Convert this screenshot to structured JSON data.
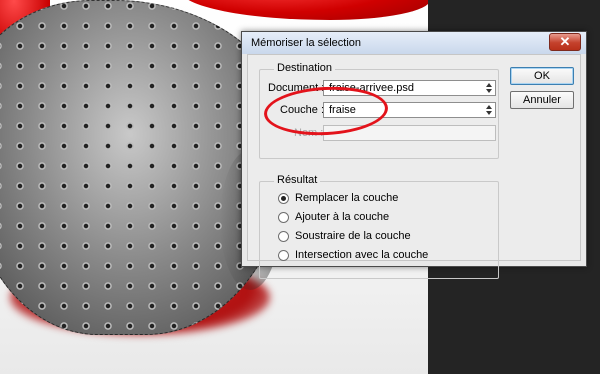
{
  "dialog": {
    "title": "Mémoriser la sélection",
    "close_glyph": "✕"
  },
  "destination": {
    "legend": "Destination",
    "document_label": "Document :",
    "document_value": "fraise-arrivee.psd",
    "channel_label": "Couche :",
    "channel_value": "fraise",
    "name_label": "Nom :",
    "name_value": ""
  },
  "result": {
    "legend": "Résultat",
    "options": [
      {
        "label": "Remplacer la couche",
        "checked": true
      },
      {
        "label": "Ajouter à la couche",
        "checked": false
      },
      {
        "label": "Soustraire de la couche",
        "checked": false
      },
      {
        "label": "Intersection avec la couche",
        "checked": false
      }
    ]
  },
  "buttons": {
    "ok": "OK",
    "cancel": "Annuler"
  },
  "colors": {
    "annotation_circle": "#e3131b",
    "side_panel": "#242424"
  }
}
